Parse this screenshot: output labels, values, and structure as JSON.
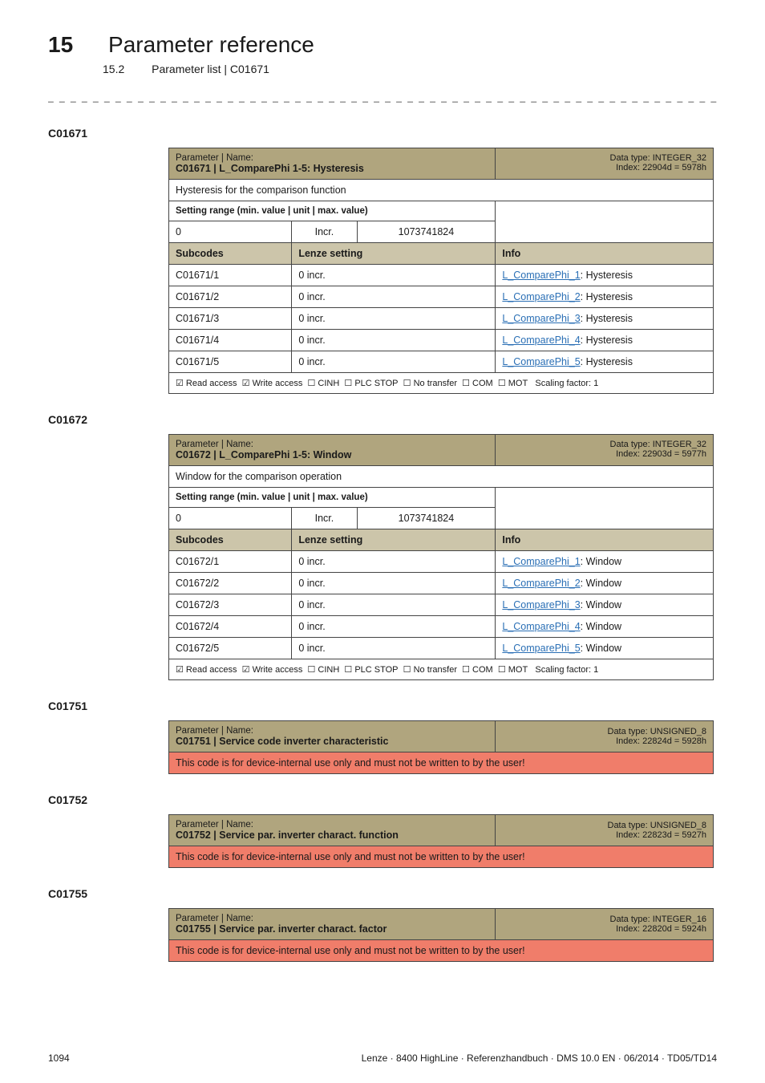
{
  "chapter": {
    "num": "15",
    "title": "Parameter reference"
  },
  "section": {
    "num": "15.2",
    "title": "Parameter list | C01671"
  },
  "dashed_rule": "_ _ _ _ _ _ _ _ _ _ _ _ _ _ _ _ _ _ _ _ _ _ _ _ _ _ _ _ _ _ _ _ _ _ _ _ _ _ _ _ _ _ _ _ _ _ _ _ _ _ _ _ _ _ _ _ _ _ _ _ _ _ _",
  "labels": {
    "param_name": "Parameter | Name:",
    "data_type_prefix": "Data type:",
    "index_prefix": "Index:",
    "setting_range": "Setting range (min. value | unit | max. value)",
    "incr": "Incr.",
    "subcodes": "Subcodes",
    "lenze_setting": "Lenze setting",
    "info": "Info",
    "read_access": "Read access",
    "write_access": "Write access",
    "cinh": "CINH",
    "plc_stop": "PLC STOP",
    "no_transfer": "No transfer",
    "com": "COM",
    "mot": "MOT",
    "scaling": "Scaling factor: 1",
    "banner": "This code is for device-internal use only and must not be written to by the user!"
  },
  "C01671": {
    "heading": "C01671",
    "code_title": "C01671 | L_ComparePhi 1-5: Hysteresis",
    "data_type": "INTEGER_32",
    "index": "22904d = 5978h",
    "desc": "Hysteresis for the comparison function",
    "range_min": "0",
    "range_incr": "Incr.",
    "range_max": "1073741824",
    "rows": [
      {
        "sub": "C01671/1",
        "set": "0 incr.",
        "link": "L_ComparePhi_1",
        "tail": ": Hysteresis"
      },
      {
        "sub": "C01671/2",
        "set": "0 incr.",
        "link": "L_ComparePhi_2",
        "tail": ": Hysteresis"
      },
      {
        "sub": "C01671/3",
        "set": "0 incr.",
        "link": "L_ComparePhi_3",
        "tail": ": Hysteresis"
      },
      {
        "sub": "C01671/4",
        "set": "0 incr.",
        "link": "L_ComparePhi_4",
        "tail": ": Hysteresis"
      },
      {
        "sub": "C01671/5",
        "set": "0 incr.",
        "link": "L_ComparePhi_5",
        "tail": ": Hysteresis"
      }
    ]
  },
  "C01672": {
    "heading": "C01672",
    "code_title": "C01672 | L_ComparePhi 1-5: Window",
    "data_type": "INTEGER_32",
    "index": "22903d = 5977h",
    "desc": "Window for the comparison operation",
    "range_min": "0",
    "range_incr": "Incr.",
    "range_max": "1073741824",
    "rows": [
      {
        "sub": "C01672/1",
        "set": "0 incr.",
        "link": "L_ComparePhi_1",
        "tail": ": Window"
      },
      {
        "sub": "C01672/2",
        "set": "0 incr.",
        "link": "L_ComparePhi_2",
        "tail": ": Window"
      },
      {
        "sub": "C01672/3",
        "set": "0 incr.",
        "link": "L_ComparePhi_3",
        "tail": ": Window"
      },
      {
        "sub": "C01672/4",
        "set": "0 incr.",
        "link": "L_ComparePhi_4",
        "tail": ": Window"
      },
      {
        "sub": "C01672/5",
        "set": "0 incr.",
        "link": "L_ComparePhi_5",
        "tail": ": Window"
      }
    ]
  },
  "C01751": {
    "heading": "C01751",
    "code_title": "C01751 | Service code inverter characteristic",
    "data_type": "UNSIGNED_8",
    "index": "22824d = 5928h"
  },
  "C01752": {
    "heading": "C01752",
    "code_title": "C01752 | Service par. inverter charact. function",
    "data_type": "UNSIGNED_8",
    "index": "22823d = 5927h"
  },
  "C01755": {
    "heading": "C01755",
    "code_title": "C01755 | Service par. inverter charact. factor",
    "data_type": "INTEGER_16",
    "index": "22820d = 5924h"
  },
  "footer": {
    "page": "1094",
    "right": "Lenze · 8400 HighLine · Referenzhandbuch · DMS 10.0 EN · 06/2014 · TD05/TD14"
  }
}
